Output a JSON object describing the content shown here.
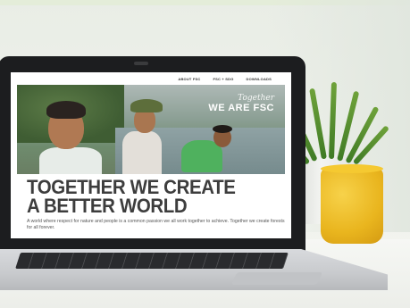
{
  "site": {
    "nav": [
      "ABOUT FSC",
      "FSC + SDG",
      "DOWNLOADS"
    ],
    "hero_tagline_script": "Together",
    "hero_tagline_strong": "WE ARE FSC",
    "headline_line1": "TOGETHER WE CREATE",
    "headline_line2": "A BETTER WORLD",
    "body_text": "A world where respect for nature and people is a common passion we all work together to achieve. Together we create forests for all forever."
  },
  "colors": {
    "accent_green": "#4fb15e",
    "headline_gray": "#3d3d3d",
    "mug_yellow": "#e9b51e"
  }
}
